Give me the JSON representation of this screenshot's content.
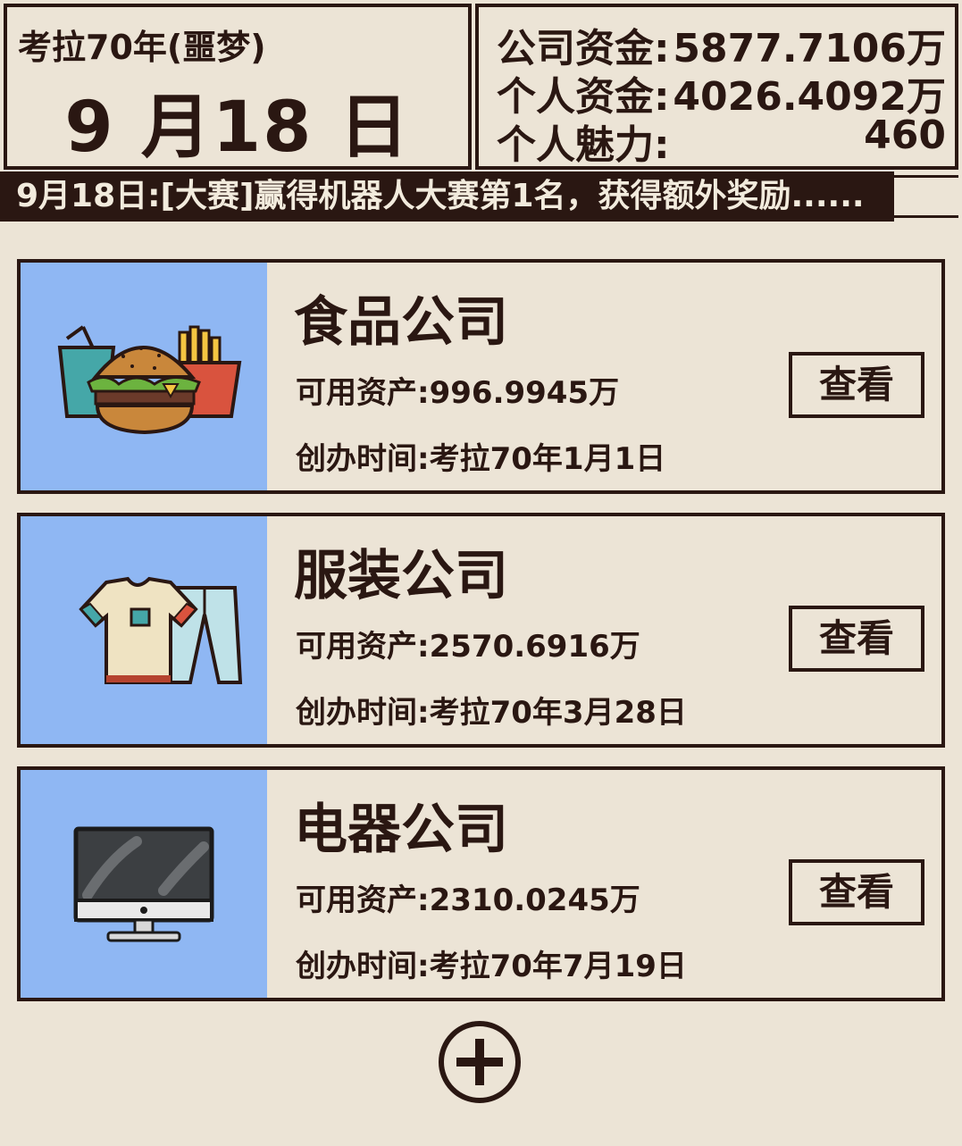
{
  "header": {
    "year": "考拉70年(噩梦)",
    "date": "9 月18 日",
    "company_funds_label": "公司资金:",
    "company_funds_value": "5877.7106万",
    "personal_funds_label": "个人资金:",
    "personal_funds_value": "4026.4092万",
    "charm_label": "个人魅力:",
    "charm_value": "460"
  },
  "ticker": {
    "text": "9月18日:[大赛]赢得机器人大赛第1名，获得额外奖励......"
  },
  "companies": [
    {
      "name": "食品公司",
      "asset": "可用资产:996.9945万",
      "founded": "创办时间:考拉70年1月1日",
      "view_label": "查看",
      "icon": "fast-food-icon"
    },
    {
      "name": "服装公司",
      "asset": "可用资产:2570.6916万",
      "founded": "创办时间:考拉70年3月28日",
      "view_label": "查看",
      "icon": "clothing-icon"
    },
    {
      "name": "电器公司",
      "asset": "可用资产:2310.0245万",
      "founded": "创办时间:考拉70年7月19日",
      "view_label": "查看",
      "icon": "monitor-icon"
    }
  ],
  "add_button": {
    "icon": "plus-circle-icon"
  },
  "colors": {
    "dark": "#2a1712",
    "background": "#ece4d6",
    "card_image_bg": "#8fb7f3"
  }
}
